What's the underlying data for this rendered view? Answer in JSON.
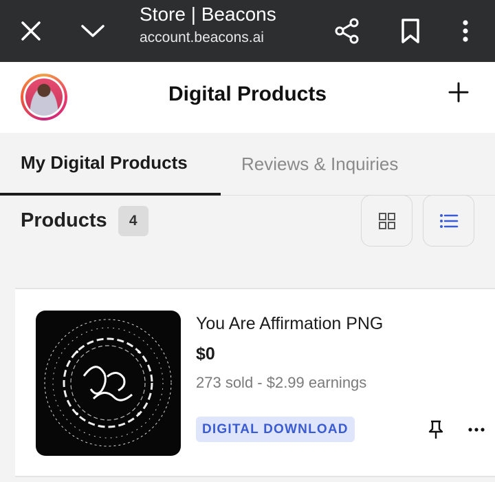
{
  "browser": {
    "title": "Store | Beacons",
    "url": "account.beacons.ai",
    "icons": [
      "close-icon",
      "chevron-down-icon",
      "share-icon",
      "bookmark-icon",
      "more-vertical-icon"
    ]
  },
  "header": {
    "title": "Digital Products",
    "add_icon": "plus-icon"
  },
  "tabs": [
    {
      "label": "My Digital Products",
      "active": true
    },
    {
      "label": "Reviews & Inquiries",
      "active": false
    }
  ],
  "products": {
    "label": "Products",
    "count": "4",
    "view_modes": [
      "grid-view-icon",
      "list-view-icon"
    ],
    "active_view": "list",
    "items": [
      {
        "name": "You Are Affirmation PNG",
        "price": "$0",
        "stats": "273 sold - $2.99 earnings",
        "badge": "DIGITAL DOWNLOAD"
      }
    ]
  },
  "colors": {
    "browser_bar": "#2d2e30",
    "accent_blue": "#3b5bd1",
    "badge_bg": "#dfe6fb",
    "avatar_ring": "#e8396a"
  }
}
